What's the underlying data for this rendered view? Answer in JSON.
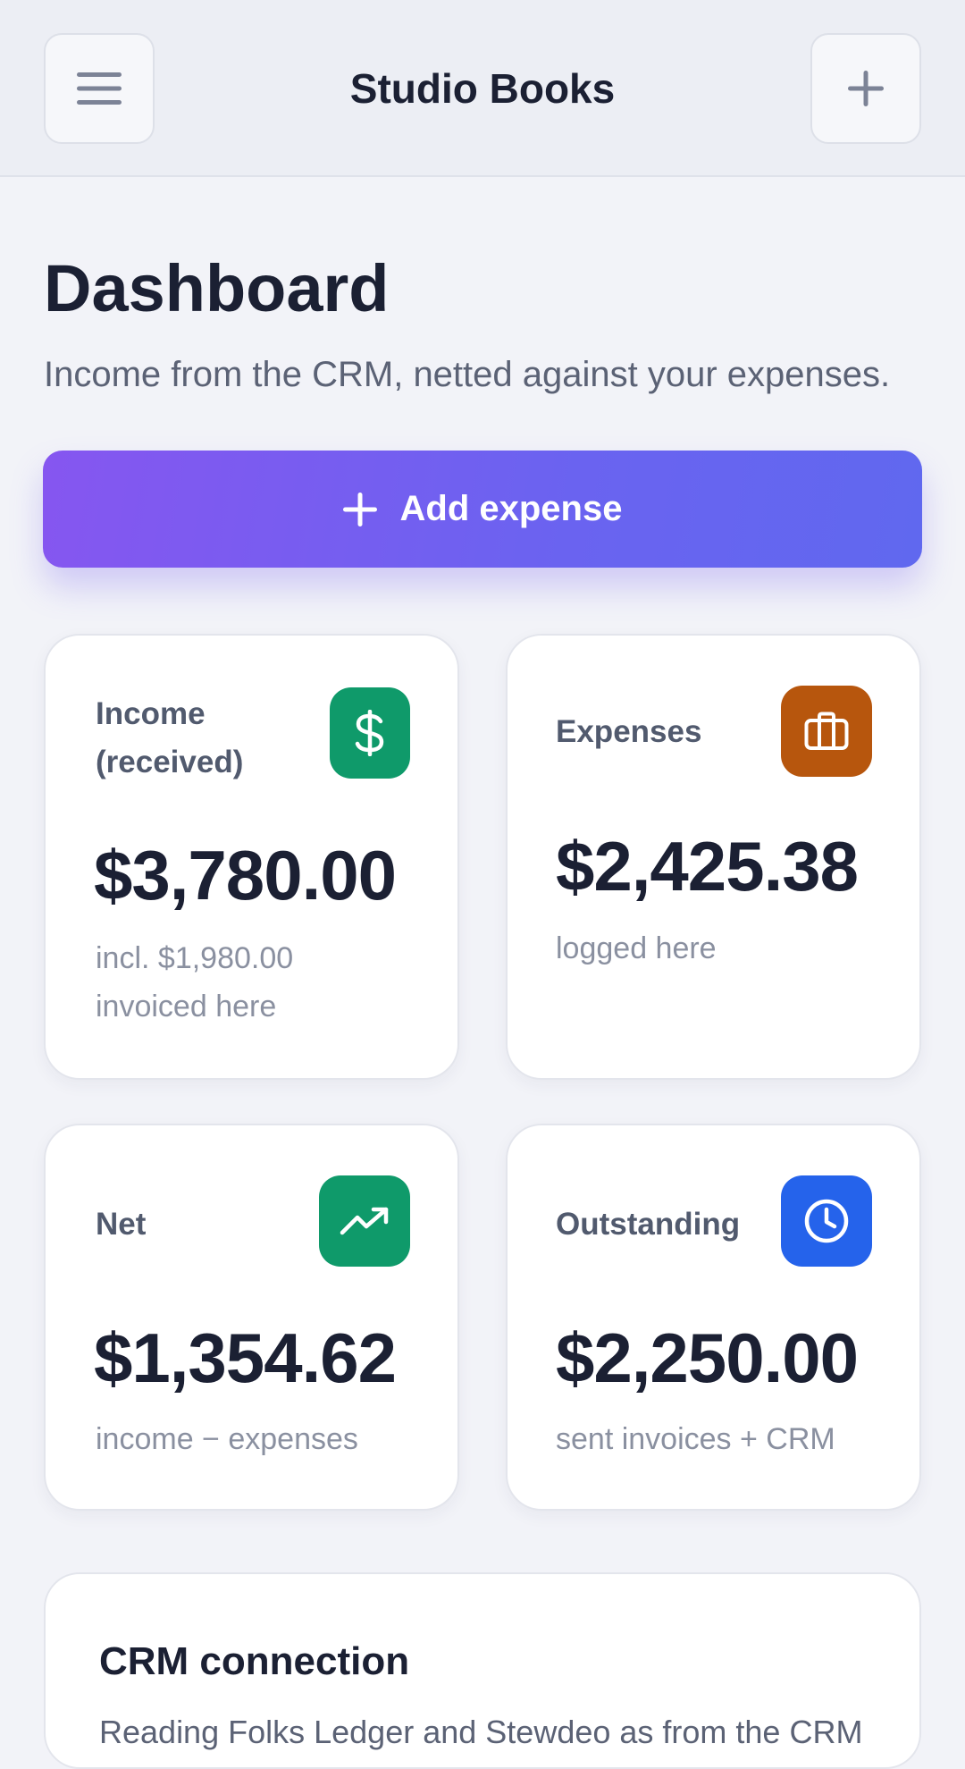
{
  "header": {
    "title": "Studio Books",
    "menu_icon": "hamburger-menu-icon",
    "add_icon": "plus-icon"
  },
  "page": {
    "title": "Dashboard",
    "subtitle": "Income from the CRM, netted against your expenses."
  },
  "add_expense": {
    "label": "Add expense",
    "icon": "plus-icon",
    "gradient": [
      "#8656f0",
      "#6068ef"
    ]
  },
  "stats": {
    "income": {
      "label": "Income (received)",
      "value": "$3,780.00",
      "note": "incl. $1,980.00 invoiced here",
      "icon": "dollar-icon",
      "color": "#0f9a6a"
    },
    "expenses": {
      "label": "Expenses",
      "value": "$2,425.38",
      "note": "logged here",
      "icon": "briefcase-icon",
      "color": "#b7560d"
    },
    "net": {
      "label": "Net",
      "value": "$1,354.62",
      "note": "income − expenses",
      "icon": "trending-up-icon",
      "color": "#0f9a6a"
    },
    "outstanding": {
      "label": "Outstanding",
      "value": "$2,250.00",
      "note": "sent invoices + CRM",
      "icon": "clock-icon",
      "color": "#2563eb"
    }
  },
  "crm": {
    "title": "CRM connection",
    "description": "Reading Folks Ledger and Stewdeo as from the CRM"
  }
}
